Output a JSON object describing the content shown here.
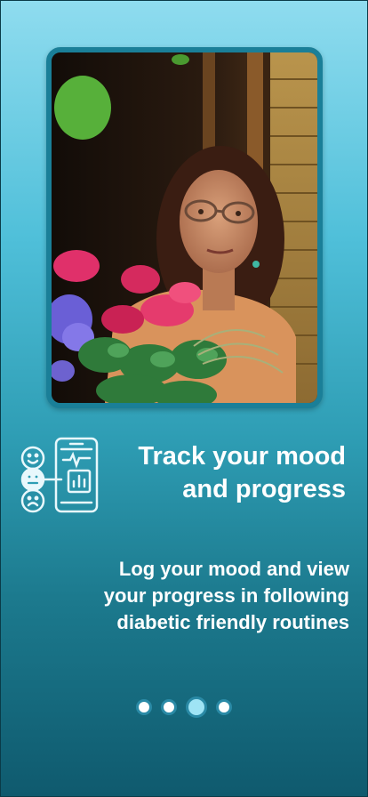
{
  "onboarding": {
    "photo_alt": "Woman at window with flowers",
    "title_line1": "Track your mood",
    "title_line2": "and progress",
    "desc_line1": "Log your mood and view",
    "desc_line2": "your progress in following",
    "desc_line3": "diabetic friendly routines"
  },
  "pager": {
    "pages": 4,
    "active_index": 2
  },
  "colors": {
    "frame_border": "#1a7f98",
    "text": "#ffffff",
    "dot_border": "#2a8aa6",
    "dot_active": "#9fe4f5"
  },
  "icons": {
    "feature": "mood-tracker-icon"
  }
}
